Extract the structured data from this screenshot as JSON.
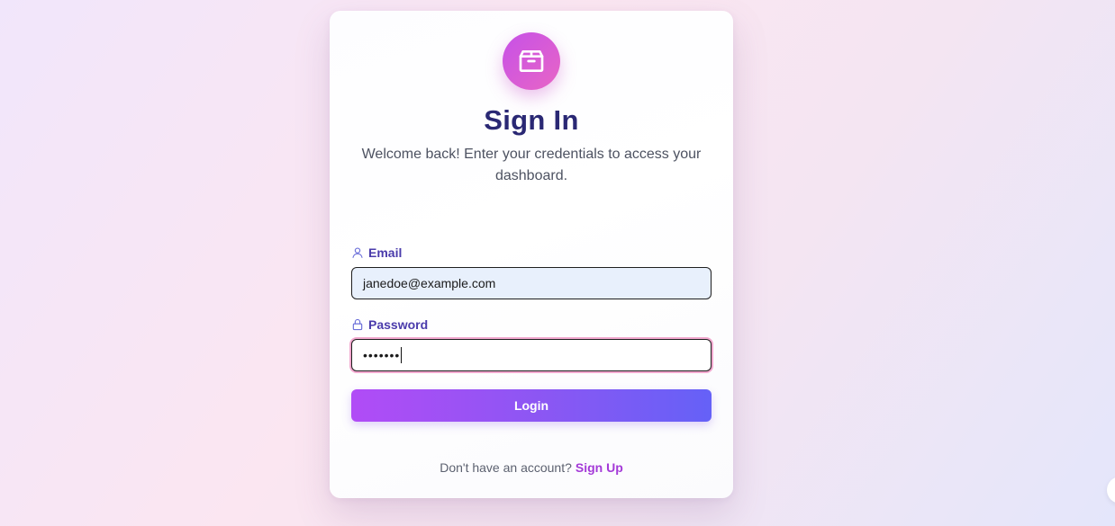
{
  "login": {
    "title": "Sign In",
    "subtitle": "Welcome back! Enter your credentials to access your dashboard.",
    "email_label": "Email",
    "email_value": "janedoe@example.com",
    "password_label": "Password",
    "password_value_masked": "•••••••",
    "login_button_label": "Login",
    "footer_text": "Don't have an account?",
    "signup_link_label": "Sign Up"
  },
  "icons": {
    "logo": "package-icon",
    "email": "user-icon",
    "password": "lock-icon"
  },
  "colors": {
    "title": "#2a2874",
    "label": "#4a3bab",
    "logo_gradient_start": "#c651e8",
    "logo_gradient_end": "#e865c5",
    "button_gradient_start": "#b14cf6",
    "button_gradient_end": "#6561f7",
    "link": "#a43ad8"
  }
}
